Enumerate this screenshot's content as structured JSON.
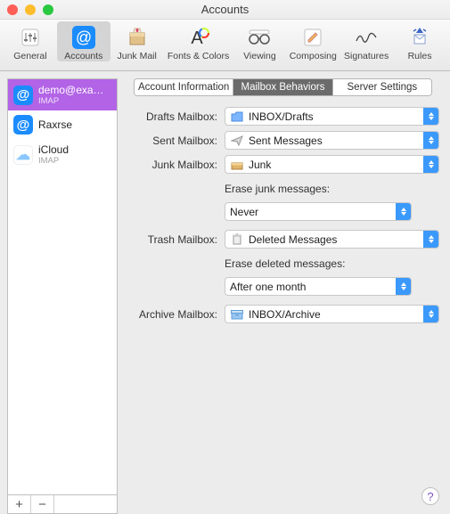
{
  "window": {
    "title": "Accounts"
  },
  "toolbar": {
    "items": [
      {
        "label": "General"
      },
      {
        "label": "Accounts"
      },
      {
        "label": "Junk Mail"
      },
      {
        "label": "Fonts & Colors"
      },
      {
        "label": "Viewing"
      },
      {
        "label": "Composing"
      },
      {
        "label": "Signatures"
      },
      {
        "label": "Rules"
      }
    ]
  },
  "accounts": [
    {
      "name": "demo@exa…",
      "sub": "IMAP"
    },
    {
      "name": "Raxrse",
      "sub": ""
    },
    {
      "name": "iCloud",
      "sub": "IMAP"
    }
  ],
  "tabs": {
    "info": "Account Information",
    "behaviors": "Mailbox Behaviors",
    "server": "Server Settings"
  },
  "form": {
    "drafts": {
      "label": "Drafts Mailbox:",
      "value": "INBOX/Drafts"
    },
    "sent": {
      "label": "Sent Mailbox:",
      "value": "Sent Messages"
    },
    "junk": {
      "label": "Junk Mailbox:",
      "value": "Junk",
      "eraseLabel": "Erase junk messages:",
      "eraseValue": "Never"
    },
    "trash": {
      "label": "Trash Mailbox:",
      "value": "Deleted Messages",
      "eraseLabel": "Erase deleted messages:",
      "eraseValue": "After one month"
    },
    "archive": {
      "label": "Archive Mailbox:",
      "value": "INBOX/Archive"
    }
  },
  "footer": {
    "add": "+",
    "remove": "−"
  },
  "help": "?"
}
